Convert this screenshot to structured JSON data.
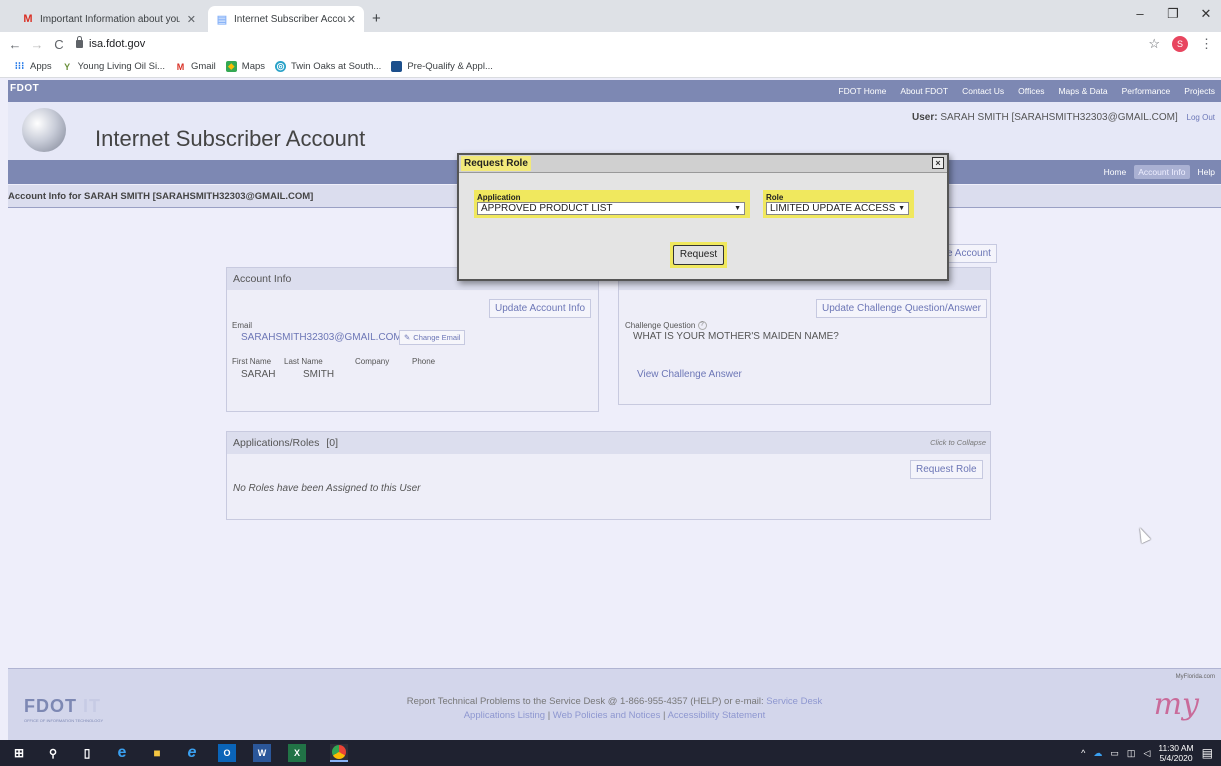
{
  "browser": {
    "tabs": [
      {
        "title": "Important Information about you",
        "active": false
      },
      {
        "title": "Internet Subscriber Account",
        "active": true
      }
    ],
    "new_tab": "+",
    "window_controls": [
      "–",
      "❐",
      "✕"
    ],
    "url": "isa.fdot.gov",
    "profile_initial": "S",
    "bookmarks": [
      {
        "label": "Apps",
        "icon": "apps-grid-icon"
      },
      {
        "label": "Young Living Oil Si...",
        "icon": "young-living-icon"
      },
      {
        "label": "Gmail",
        "icon": "gmail-icon"
      },
      {
        "label": "Maps",
        "icon": "maps-icon"
      },
      {
        "label": "Twin Oaks at South...",
        "icon": "twin-oaks-icon"
      },
      {
        "label": "Pre-Qualify & Appl...",
        "icon": "prequalify-icon"
      }
    ]
  },
  "site": {
    "small_logo": "FDOT",
    "top_nav": [
      "FDOT Home",
      "About FDOT",
      "Contact Us",
      "Offices",
      "Maps & Data",
      "Performance",
      "Projects"
    ],
    "title": "Internet Subscriber Account",
    "user_label": "User:",
    "user_value": "SARAH SMITH [SARAHSMITH32303@GMAIL.COM]",
    "logout": "Log Out",
    "sub_nav": [
      "Home",
      "Account Info",
      "Help"
    ],
    "sub_nav_current": "Account Info",
    "account_bar": "Account Info for SARAH SMITH [SARAHSMITH32303@GMAIL.COM]"
  },
  "account_info": {
    "title": "Account Info",
    "update_button": "Update Account Info",
    "email_label": "Email",
    "email_value": "SARAHSMITH32303@GMAIL.COM",
    "change_email": "Change Email",
    "first_name_label": "First Name",
    "last_name_label": "Last Name",
    "company_label": "Company",
    "phone_label": "Phone",
    "first_name": "SARAH",
    "last_name": "SMITH",
    "company": "",
    "phone": ""
  },
  "challenge": {
    "partial_button": "ite Account",
    "update_button": "Update Challenge Question/Answer",
    "question_label": "Challenge Question",
    "help": "?",
    "question_value": "WHAT IS YOUR MOTHER'S MAIDEN NAME?",
    "view_answer": "View Challenge Answer"
  },
  "roles": {
    "title": "Applications/Roles",
    "count": "[0]",
    "collapse": "Click to Collapse",
    "request_button": "Request Role",
    "empty_message": "No Roles have been Assigned to this User"
  },
  "modal": {
    "title": "Request Role",
    "close": "×",
    "application_label": "Application",
    "application_value": "APPROVED PRODUCT LIST",
    "role_label": "Role",
    "role_value": "LIMITED UPDATE ACCESS",
    "request_button": "Request"
  },
  "footer": {
    "logo": "FDOT",
    "logo_it": "IT",
    "logo_sub": "OFFICE OF INFORMATION TECHNOLOGY",
    "line1": "Report Technical Problems to the Service Desk @ 1-866-955-4357 (HELP) or e-mail:",
    "service_desk": "Service Desk",
    "links": [
      "Applications Listing",
      "Web Policies and Notices",
      "Accessibility Statement"
    ],
    "myflorida_small": "MyFlorida.com",
    "myflorida_logo": "my"
  },
  "taskbar": {
    "time": "11:30 AM",
    "date": "5/4/2020"
  },
  "colors": {
    "nav_bar": "#7d88b3",
    "link": "#6c76b6",
    "highlight": "#f0e85e"
  }
}
